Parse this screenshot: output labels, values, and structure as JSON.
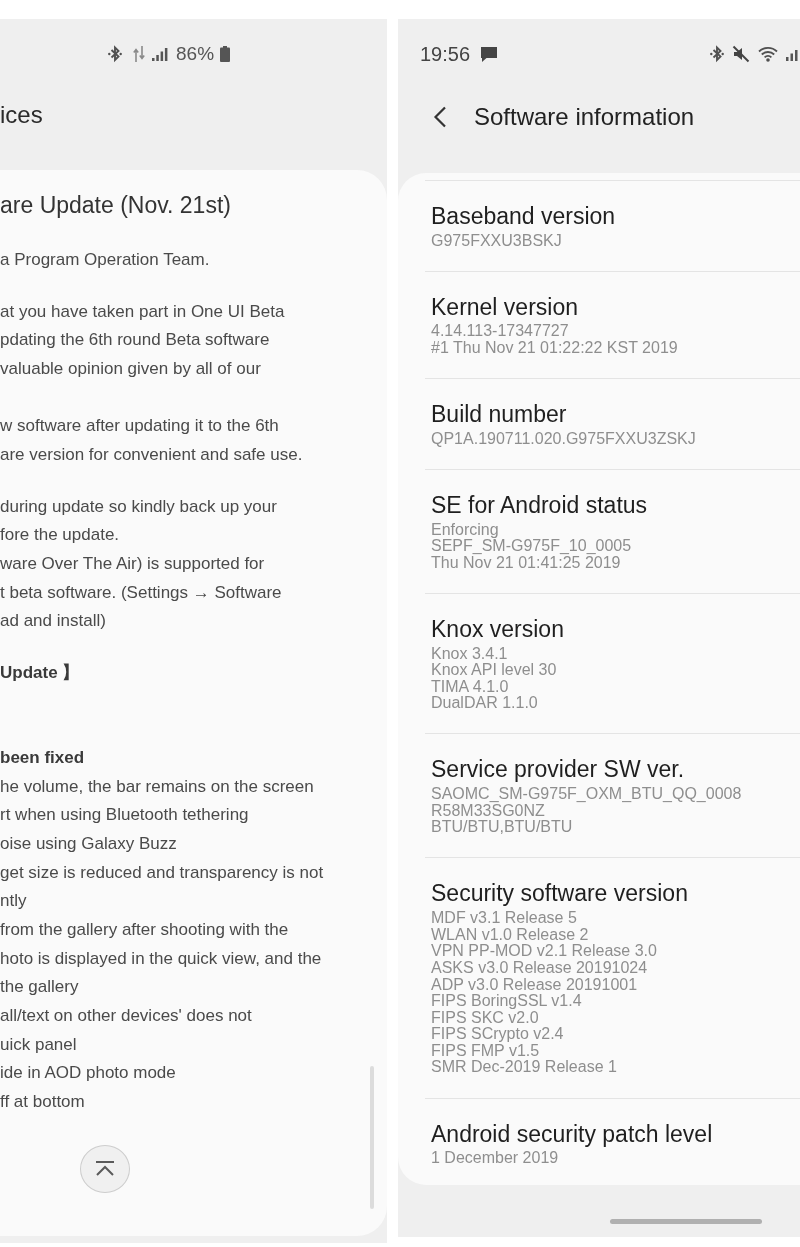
{
  "left_screen": {
    "status_bar": {
      "battery": "86%"
    },
    "title": "ices",
    "article": {
      "title": "are Update (Nov. 21st)",
      "blocks": [
        {
          "kind": "paragraph",
          "lines": [
            "a Program Operation Team."
          ]
        },
        {
          "kind": "paragraph",
          "lines": [
            "at you have taken part in One UI Beta",
            "pdating the 6th round Beta software",
            "valuable opinion given by all of our"
          ]
        },
        {
          "kind": "section",
          "lines": [
            "w software after updating it to the 6th",
            "are version for convenient and safe use."
          ]
        },
        {
          "kind": "paragraph",
          "lines": [
            "during update so kindly back up your",
            "fore the update."
          ]
        },
        {
          "kind": "item",
          "lines": [
            "ware Over The Air) is supported for",
            "t beta software. (Settings → Software",
            "ad and install)"
          ]
        },
        {
          "kind": "heading",
          "lines": [
            "Update 】"
          ]
        },
        {
          "kind": "subheading",
          "lines": [
            "been fixed"
          ]
        },
        {
          "kind": "item",
          "lines": [
            "he volume, the bar remains on the screen"
          ]
        },
        {
          "kind": "item",
          "lines": [
            "rt when using Bluetooth tethering"
          ]
        },
        {
          "kind": "item",
          "lines": [
            "oise using Galaxy Buzz"
          ]
        },
        {
          "kind": "item",
          "lines": [
            "get size is reduced and transparency is not",
            "ntly"
          ]
        },
        {
          "kind": "item",
          "lines": [
            "from the gallery after shooting with the",
            "hoto is displayed in the quick view, and the",
            "the gallery"
          ]
        },
        {
          "kind": "item",
          "lines": [
            "all/text on other devices' does not",
            "uick panel"
          ]
        },
        {
          "kind": "item",
          "lines": [
            "ide in AOD photo mode"
          ]
        },
        {
          "kind": "item",
          "lines": [
            "ff at bottom"
          ]
        }
      ]
    }
  },
  "right_screen": {
    "status_bar": {
      "time": "19:56"
    },
    "header": {
      "title": "Software information"
    },
    "items": [
      {
        "title": "Baseband version",
        "lines": [
          "G975FXXU3BSKJ"
        ]
      },
      {
        "title": "Kernel version",
        "lines": [
          "4.14.113-17347727",
          "#1 Thu Nov 21 01:22:22 KST 2019"
        ]
      },
      {
        "title": "Build number",
        "lines": [
          "QP1A.190711.020.G975FXXU3ZSKJ"
        ]
      },
      {
        "title": "SE for Android status",
        "lines": [
          "Enforcing",
          "SEPF_SM-G975F_10_0005",
          "Thu Nov 21 01:41:25 2019"
        ]
      },
      {
        "title": "Knox version",
        "lines": [
          "Knox 3.4.1",
          "Knox API level 30",
          "TIMA 4.1.0",
          "DualDAR 1.1.0"
        ]
      },
      {
        "title": "Service provider SW ver.",
        "lines": [
          "SAOMC_SM-G975F_OXM_BTU_QQ_0008",
          "R58M33SG0NZ",
          "BTU/BTU,BTU/BTU"
        ]
      },
      {
        "title": "Security software version",
        "lines": [
          "MDF v3.1 Release 5",
          "WLAN v1.0 Release 2",
          "VPN PP-MOD v2.1 Release 3.0",
          "ASKS v3.0 Release 20191024",
          "ADP v3.0 Release 20191001",
          "FIPS BoringSSL v1.4",
          "FIPS SKC v2.0",
          "FIPS SCrypto v2.4",
          "FIPS FMP v1.5",
          "SMR Dec-2019 Release 1"
        ]
      },
      {
        "title": "Android security patch level",
        "lines": [
          "1 December 2019"
        ]
      }
    ]
  }
}
